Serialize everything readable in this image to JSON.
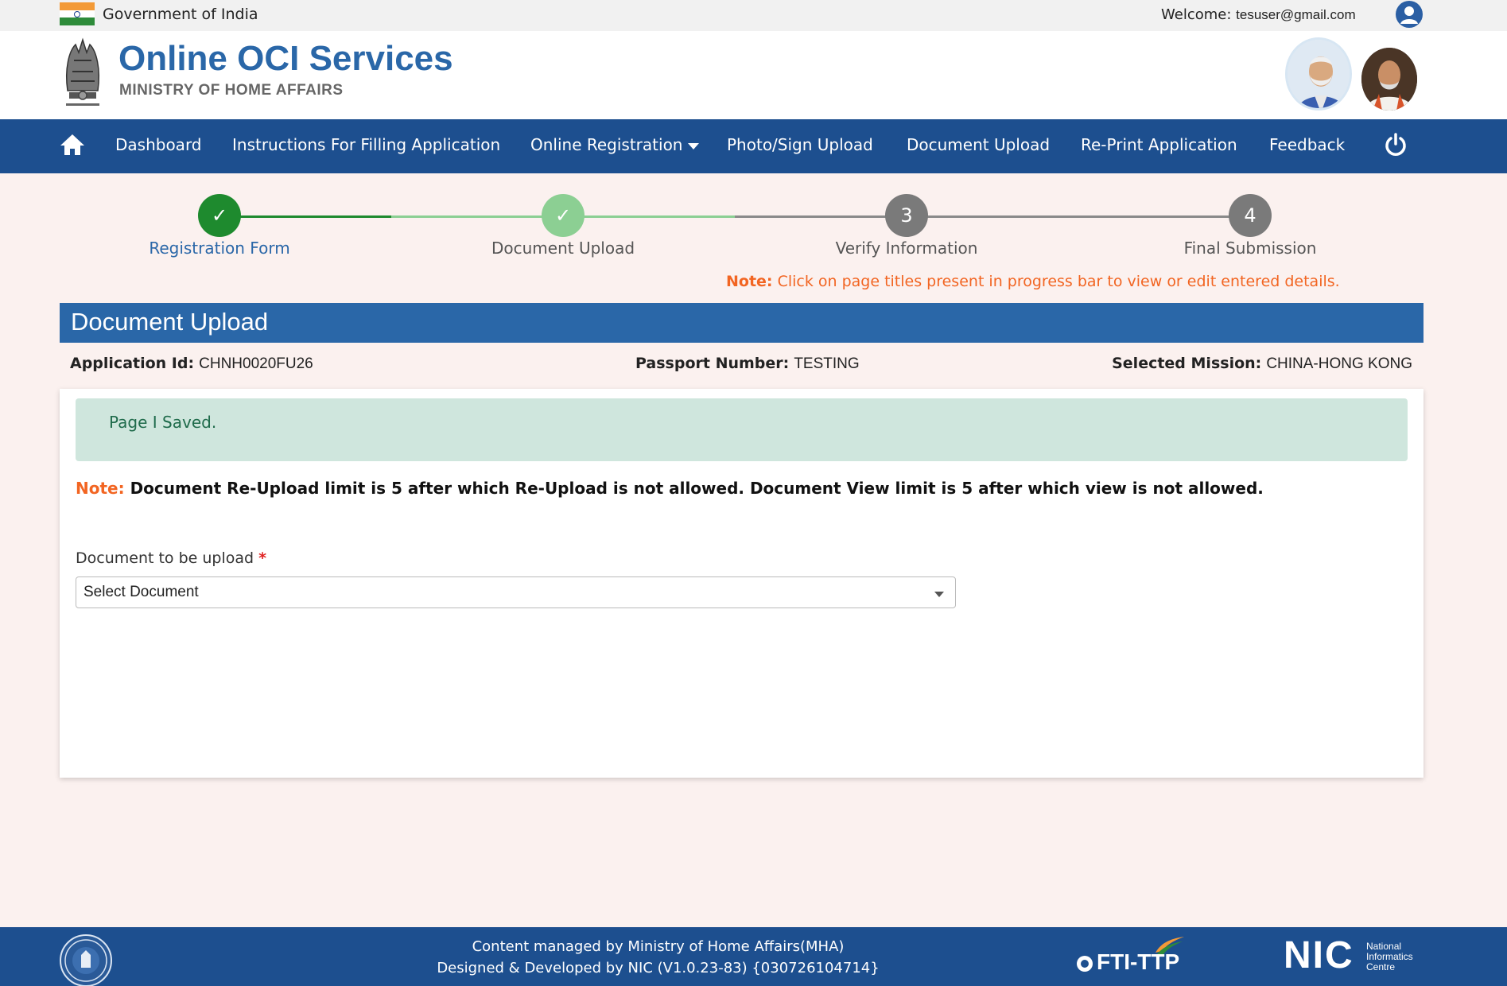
{
  "gov_bar": {
    "text": "Government of India",
    "welcome_label": "Welcome:",
    "email": "tesuser@gmail.com"
  },
  "header": {
    "title": "Online OCI Services",
    "subtitle": "MINISTRY OF HOME AFFAIRS"
  },
  "nav": {
    "items": [
      {
        "label": "Dashboard"
      },
      {
        "label": "Instructions For Filling Application"
      },
      {
        "label": "Online Registration"
      },
      {
        "label": "Photo/Sign Upload"
      },
      {
        "label": "Document Upload"
      },
      {
        "label": "Re-Print Application"
      },
      {
        "label": "Feedback"
      }
    ]
  },
  "stepper": {
    "steps": [
      {
        "marker": "✓",
        "label": "Registration Form",
        "status": "completed"
      },
      {
        "marker": "✓",
        "label": "Document Upload",
        "status": "current"
      },
      {
        "marker": "3",
        "label": "Verify Information",
        "status": "pending"
      },
      {
        "marker": "4",
        "label": "Final Submission",
        "status": "pending"
      }
    ],
    "note_label": "Note:",
    "note_text": " Click on page titles present in progress bar to view or edit entered details."
  },
  "section": {
    "title": "Document Upload"
  },
  "info": {
    "application_id_label": "Application Id:",
    "application_id": "CHNH0020FU26",
    "passport_label": "Passport Number:",
    "passport": "TESTING",
    "mission_label": "Selected Mission:",
    "mission": "CHINA-HONG KONG"
  },
  "alert": {
    "text": "Page I Saved."
  },
  "doc_note": {
    "label": "Note:",
    "text": " Document Re-Upload limit is 5 after which Re-Upload is not allowed. Document View limit is 5 after which view is not allowed."
  },
  "form": {
    "doc_label": "Document to be upload",
    "required_mark": "*",
    "select_value": "Select Document"
  },
  "footer": {
    "line1": "Content managed by Ministry of Home Affairs(MHA)",
    "line2": "Designed & Developed by NIC (V1.0.23-83) {030726104714}",
    "fti_text": "FTI-TTP",
    "nic_text": "NIC",
    "nic_sub": "National Informatics Centre"
  },
  "colors": {
    "nav_bg": "#1d4f8f",
    "section_bg": "#2a67a8",
    "step_done": "#1e8a2e",
    "step_current": "#8ccf93",
    "step_pending": "#7a7a7a",
    "note": "#f26522"
  }
}
